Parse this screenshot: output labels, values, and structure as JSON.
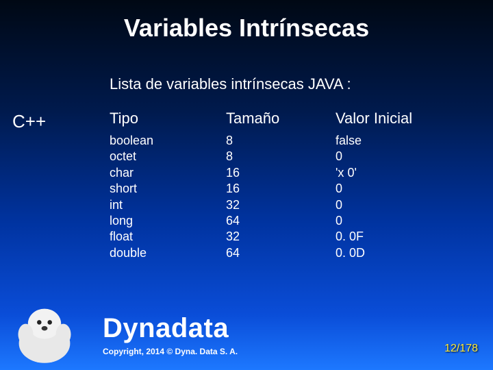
{
  "title": "Variables Intrínsecas",
  "subtitle": "Lista de variables intrínsecas JAVA :",
  "sidelabel": "C++",
  "headers": {
    "tipo": "Tipo",
    "tam": "Tamaño",
    "val": "Valor Inicial"
  },
  "rows": [
    {
      "tipo": "boolean",
      "tam": "8",
      "val": "false"
    },
    {
      "tipo": "octet",
      "tam": "8",
      "val": "0"
    },
    {
      "tipo": "char",
      "tam": "16",
      "val": "'x 0'"
    },
    {
      "tipo": "short",
      "tam": "16",
      "val": "0"
    },
    {
      "tipo": "int",
      "tam": "32",
      "val": "0"
    },
    {
      "tipo": "long",
      "tam": "64",
      "val": "0"
    },
    {
      "tipo": "float",
      "tam": "32",
      "val": "0. 0F"
    },
    {
      "tipo": "double",
      "tam": "64",
      "val": "0. 0D"
    }
  ],
  "brand": "Dynadata",
  "copyright": "Copyright, 2014 © Dyna. Data S. A.",
  "page": "12/178"
}
